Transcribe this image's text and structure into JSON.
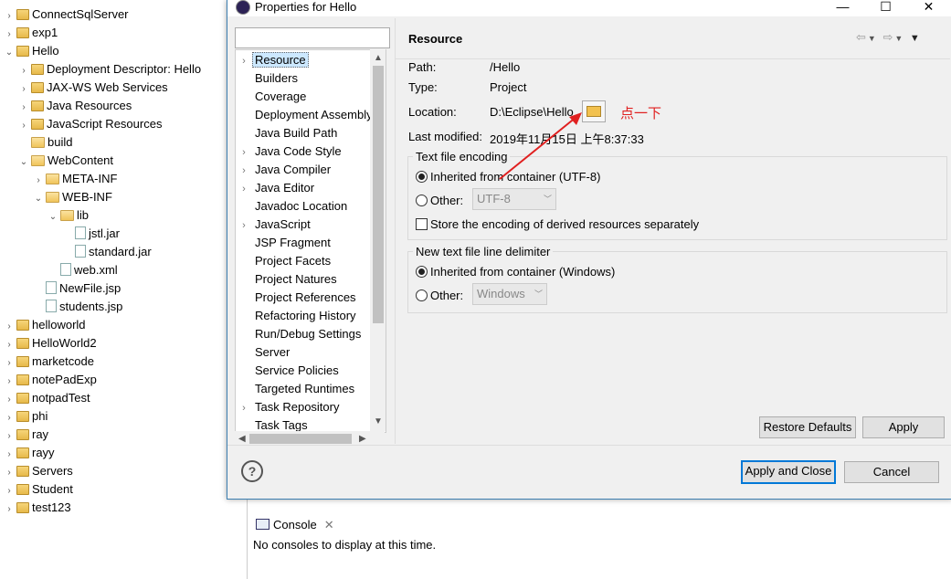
{
  "explorer": {
    "items": [
      {
        "label": "ConnectSqlServer",
        "twisty": ">",
        "icon": "project-icon"
      },
      {
        "label": "exp1",
        "twisty": ">",
        "icon": "project-icon"
      },
      {
        "label": "Hello",
        "twisty": "v",
        "icon": "project-icon"
      },
      {
        "label": "Deployment Descriptor: Hello",
        "twisty": ">",
        "icon": "descriptor-icon"
      },
      {
        "label": "JAX-WS Web Services",
        "twisty": ">",
        "icon": "webservice-icon"
      },
      {
        "label": "Java Resources",
        "twisty": ">",
        "icon": "java-resources-icon"
      },
      {
        "label": "JavaScript Resources",
        "twisty": ">",
        "icon": "js-resources-icon"
      },
      {
        "label": "build",
        "twisty": "",
        "icon": "folder-icon"
      },
      {
        "label": "WebContent",
        "twisty": "v",
        "icon": "folder-icon"
      },
      {
        "label": "META-INF",
        "twisty": ">",
        "icon": "folder-icon"
      },
      {
        "label": "WEB-INF",
        "twisty": "v",
        "icon": "folder-icon"
      },
      {
        "label": "lib",
        "twisty": "v",
        "icon": "folder-icon"
      },
      {
        "label": "jstl.jar",
        "twisty": "",
        "icon": "jar-icon"
      },
      {
        "label": "standard.jar",
        "twisty": "",
        "icon": "jar-icon"
      },
      {
        "label": "web.xml",
        "twisty": "",
        "icon": "xml-file-icon"
      },
      {
        "label": "NewFile.jsp",
        "twisty": "",
        "icon": "jsp-file-icon"
      },
      {
        "label": "students.jsp",
        "twisty": "",
        "icon": "jsp-file-icon"
      },
      {
        "label": "helloworld",
        "twisty": ">",
        "icon": "project-icon"
      },
      {
        "label": "HelloWorld2",
        "twisty": ">",
        "icon": "project-icon"
      },
      {
        "label": "marketcode",
        "twisty": ">",
        "icon": "project-icon"
      },
      {
        "label": "notePadExp",
        "twisty": ">",
        "icon": "project-icon"
      },
      {
        "label": "notpadTest",
        "twisty": ">",
        "icon": "project-icon"
      },
      {
        "label": "phi",
        "twisty": ">",
        "icon": "project-icon"
      },
      {
        "label": "ray",
        "twisty": ">",
        "icon": "project-icon"
      },
      {
        "label": "rayy",
        "twisty": ">",
        "icon": "project-icon"
      },
      {
        "label": "Servers",
        "twisty": ">",
        "icon": "project-icon"
      },
      {
        "label": "Student",
        "twisty": ">",
        "icon": "project-icon"
      },
      {
        "label": "test123",
        "twisty": ">",
        "icon": "project-icon"
      }
    ]
  },
  "dialog": {
    "title": "Properties for Hello",
    "window_buttons": {
      "minimize": "—",
      "maximize": "☐",
      "close": "✕"
    },
    "filter_placeholder": "",
    "categories": [
      {
        "label": "Resource",
        "expandable": true,
        "selected": true
      },
      {
        "label": "Builders",
        "expandable": false
      },
      {
        "label": "Coverage",
        "expandable": false
      },
      {
        "label": "Deployment Assembly",
        "expandable": false
      },
      {
        "label": "Java Build Path",
        "expandable": false
      },
      {
        "label": "Java Code Style",
        "expandable": true
      },
      {
        "label": "Java Compiler",
        "expandable": true
      },
      {
        "label": "Java Editor",
        "expandable": true
      },
      {
        "label": "Javadoc Location",
        "expandable": false
      },
      {
        "label": "JavaScript",
        "expandable": true
      },
      {
        "label": "JSP Fragment",
        "expandable": false
      },
      {
        "label": "Project Facets",
        "expandable": false
      },
      {
        "label": "Project Natures",
        "expandable": false
      },
      {
        "label": "Project References",
        "expandable": false
      },
      {
        "label": "Refactoring History",
        "expandable": false
      },
      {
        "label": "Run/Debug Settings",
        "expandable": false
      },
      {
        "label": "Server",
        "expandable": false
      },
      {
        "label": "Service Policies",
        "expandable": false
      },
      {
        "label": "Targeted Runtimes",
        "expandable": false
      },
      {
        "label": "Task Repository",
        "expandable": true
      },
      {
        "label": "Task Tags",
        "expandable": false
      }
    ],
    "page": {
      "title": "Resource",
      "path_label": "Path:",
      "path_value": "/Hello",
      "type_label": "Type:",
      "type_value": "Project",
      "location_label": "Location:",
      "location_value": "D:\\Eclipse\\Hello",
      "modified_label": "Last modified:",
      "modified_value": "2019年11月15日 上午8:37:33",
      "encoding_group": "Text file encoding",
      "encoding_inherited": "Inherited from container (UTF-8)",
      "encoding_other": "Other:",
      "encoding_other_value": "UTF-8",
      "store_encoding": "Store the encoding of derived resources separately",
      "delimiter_group": "New text file line delimiter",
      "delimiter_inherited": "Inherited from container (Windows)",
      "delimiter_other": "Other:",
      "delimiter_other_value": "Windows",
      "annotation": "点一下"
    },
    "buttons": {
      "restore_defaults": "Restore Defaults",
      "apply": "Apply",
      "apply_close": "Apply and Close",
      "cancel": "Cancel"
    }
  },
  "console": {
    "tab_label": "Console",
    "message": "No consoles to display at this time."
  },
  "colors": {
    "annotation": "#e02020",
    "dialog_border": "#3c7fb1",
    "selection": "#cce8ff"
  }
}
